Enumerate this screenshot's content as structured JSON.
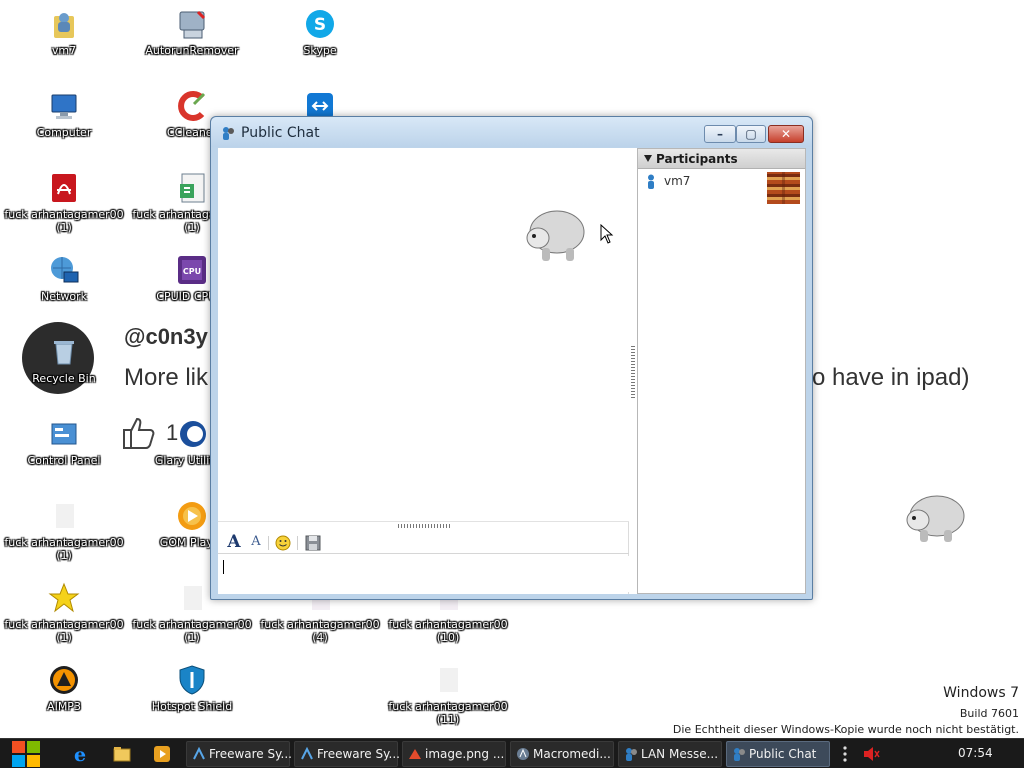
{
  "desktop": {
    "icons": [
      {
        "label": "vm7"
      },
      {
        "label": "AutorunRemover"
      },
      {
        "label": "Skype"
      },
      {
        "label": "Computer"
      },
      {
        "label": "CCleaner"
      },
      {
        "label": "fuck arhantagamer00",
        "label2": "(1)"
      },
      {
        "label": "fuck arhantagamer00",
        "label2": "(1)"
      },
      {
        "label": "Network"
      },
      {
        "label": "CPUID CPU-Z"
      },
      {
        "label": "Recycle Bin"
      },
      {
        "label": "Control Panel"
      },
      {
        "label": "Glary Utilities"
      },
      {
        "label": "fuck arhantagamer00",
        "label2": "(1)"
      },
      {
        "label": "GOM Player"
      },
      {
        "label": "fuck arhantagamer00",
        "label2": "(1)"
      },
      {
        "label": "fuck arhantagamer00",
        "label2": "(1)"
      },
      {
        "label": "fuck arhantagamer00",
        "label2": "(4)"
      },
      {
        "label": "fuck arhantagamer00",
        "label2": "(10)"
      },
      {
        "label": "AIMP3"
      },
      {
        "label": "Hotspot Shield"
      },
      {
        "label": "fuck arhantagamer00",
        "label2": "(11)"
      }
    ]
  },
  "background_fragments": {
    "handle": "@c0n3y",
    "more": "More lik",
    "ipad": "o have in ipad)",
    "like_count": "1"
  },
  "chat_window": {
    "title": "Public Chat",
    "buttons": {
      "minimize": "–",
      "maximize": "▢",
      "close": "✕"
    },
    "toolbar": {
      "font_icon": "A",
      "color_icon": "A"
    },
    "input_value": "",
    "participants_header": "Participants",
    "participants": [
      {
        "name": "vm7"
      }
    ]
  },
  "taskbar": {
    "tasks": [
      {
        "label": "Freeware Sy...",
        "icon": "dreamweaver-icon"
      },
      {
        "label": "Freeware Sy...",
        "icon": "dreamweaver-icon"
      },
      {
        "label": "image.png ...",
        "icon": "image-icon"
      },
      {
        "label": "Macromedi...",
        "icon": "macromedia-icon"
      },
      {
        "label": "LAN Messe...",
        "icon": "lan-messenger-icon"
      },
      {
        "label": "Public Chat",
        "icon": "lan-messenger-icon"
      }
    ],
    "clock": "07:54"
  },
  "watermark": {
    "os": "Windows 7",
    "build": "Build 7601",
    "notice": "Die Echtheit dieser Windows-Kopie wurde noch nicht bestätigt."
  },
  "colors": {
    "window_frame": "#bdd4ea",
    "taskbar": "#1a1a1a",
    "close_button": "#c6402c"
  }
}
